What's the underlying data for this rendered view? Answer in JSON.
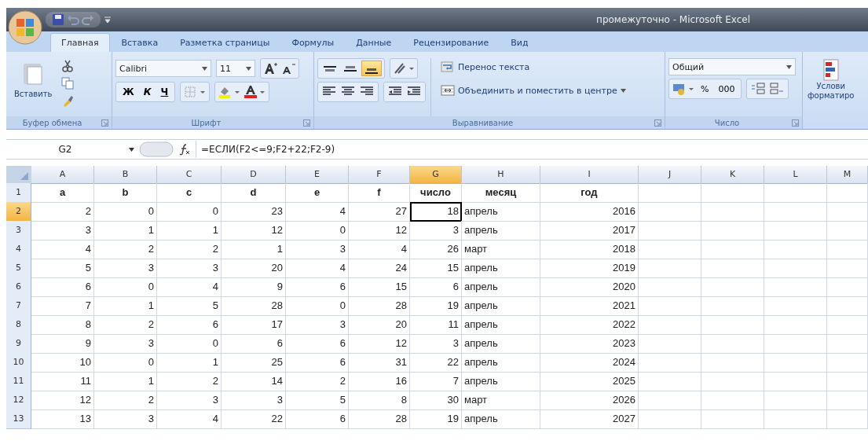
{
  "window": {
    "title": "промежуточно - Microsoft Excel"
  },
  "tabs": [
    {
      "label": "Главная",
      "selected": true
    },
    {
      "label": "Вставка",
      "selected": false
    },
    {
      "label": "Разметка страницы",
      "selected": false
    },
    {
      "label": "Формулы",
      "selected": false
    },
    {
      "label": "Данные",
      "selected": false
    },
    {
      "label": "Рецензирование",
      "selected": false
    },
    {
      "label": "Вид",
      "selected": false
    }
  ],
  "ribbon": {
    "clipboard": {
      "paste_label": "Вставить",
      "group_label": "Буфер обмена"
    },
    "font": {
      "font_name": "Calibri",
      "font_size": "11",
      "bold": "Ж",
      "italic": "К",
      "underline": "Ч",
      "group_label": "Шрифт"
    },
    "alignment": {
      "vertical": [
        {
          "kind": "top",
          "on": false
        },
        {
          "kind": "middle",
          "on": false
        },
        {
          "kind": "bottom",
          "on": true
        }
      ],
      "wrap_label": "Перенос текста",
      "merge_label": "Объединить и поместить в центре",
      "group_label": "Выравнивание"
    },
    "number": {
      "format": "Общий",
      "percent": "%",
      "thousands": "000",
      "group_label": "Число"
    },
    "styles": {
      "label_lines": [
        "Услови",
        "форматиро"
      ]
    }
  },
  "formula_bar": {
    "name_box": "G2",
    "formula": "=ЕСЛИ(F2<=9;F2+22;F2-9)"
  },
  "sheet": {
    "columns": [
      {
        "label": "A",
        "kind": "number",
        "selected": false
      },
      {
        "label": "B",
        "kind": "number",
        "selected": false
      },
      {
        "label": "C",
        "kind": "number",
        "selected": false
      },
      {
        "label": "D",
        "kind": "number",
        "selected": false
      },
      {
        "label": "E",
        "kind": "number",
        "selected": false
      },
      {
        "label": "F",
        "kind": "number",
        "selected": false
      },
      {
        "label": "G",
        "kind": "number",
        "selected": true
      },
      {
        "label": "H",
        "kind": "text",
        "selected": false
      },
      {
        "label": "I",
        "kind": "number",
        "selected": false
      },
      {
        "label": "J",
        "kind": "number",
        "selected": false
      },
      {
        "label": "K",
        "kind": "number",
        "selected": false
      },
      {
        "label": "L",
        "kind": "number",
        "selected": false
      },
      {
        "label": "M",
        "kind": "number",
        "selected": false
      }
    ],
    "rows": [
      {
        "header": "1",
        "kind": "header",
        "selected": false,
        "cells": [
          "a",
          "b",
          "c",
          "d",
          "e",
          "f",
          "число",
          "месяц",
          "год"
        ]
      },
      {
        "header": "2",
        "kind": "data",
        "selected": true,
        "cells": [
          "2",
          "0",
          "0",
          "23",
          "4",
          "27",
          "18",
          "апрель",
          "2016"
        ]
      },
      {
        "header": "3",
        "kind": "data",
        "selected": false,
        "cells": [
          "3",
          "1",
          "1",
          "12",
          "0",
          "12",
          "3",
          "апрель",
          "2017"
        ]
      },
      {
        "header": "4",
        "kind": "data",
        "selected": false,
        "cells": [
          "4",
          "2",
          "2",
          "1",
          "3",
          "4",
          "26",
          "март",
          "2018"
        ]
      },
      {
        "header": "5",
        "kind": "data",
        "selected": false,
        "cells": [
          "5",
          "3",
          "3",
          "20",
          "4",
          "24",
          "15",
          "апрель",
          "2019"
        ]
      },
      {
        "header": "6",
        "kind": "data",
        "selected": false,
        "cells": [
          "6",
          "0",
          "4",
          "9",
          "6",
          "15",
          "6",
          "апрель",
          "2020"
        ]
      },
      {
        "header": "7",
        "kind": "data",
        "selected": false,
        "cells": [
          "7",
          "1",
          "5",
          "28",
          "0",
          "28",
          "19",
          "апрель",
          "2021"
        ]
      },
      {
        "header": "8",
        "kind": "data",
        "selected": false,
        "cells": [
          "8",
          "2",
          "6",
          "17",
          "3",
          "20",
          "11",
          "апрель",
          "2022"
        ]
      },
      {
        "header": "9",
        "kind": "data",
        "selected": false,
        "cells": [
          "9",
          "3",
          "0",
          "6",
          "6",
          "12",
          "3",
          "апрель",
          "2023"
        ]
      },
      {
        "header": "10",
        "kind": "data",
        "selected": false,
        "cells": [
          "10",
          "0",
          "1",
          "25",
          "6",
          "31",
          "22",
          "апрель",
          "2024"
        ]
      },
      {
        "header": "11",
        "kind": "data",
        "selected": false,
        "cells": [
          "11",
          "1",
          "2",
          "14",
          "2",
          "16",
          "7",
          "апрель",
          "2025"
        ]
      },
      {
        "header": "12",
        "kind": "data",
        "selected": false,
        "cells": [
          "12",
          "2",
          "3",
          "3",
          "5",
          "8",
          "30",
          "март",
          "2026"
        ]
      },
      {
        "header": "13",
        "kind": "data",
        "selected": false,
        "cells": [
          "13",
          "3",
          "4",
          "22",
          "6",
          "28",
          "19",
          "апрель",
          "2027"
        ]
      }
    ]
  }
}
